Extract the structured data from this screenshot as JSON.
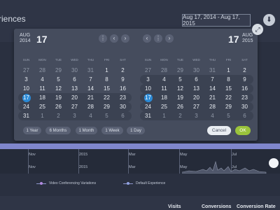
{
  "header": {
    "title": "riences",
    "date_range": "Aug 17, 2014 - Aug 17, 2015",
    "download_icon": "download-icon",
    "expand_icon": "expand-icon"
  },
  "calendars": {
    "left": {
      "month": "AUG",
      "year": "2014",
      "selected_day": "17",
      "buttons": [
        "⋮",
        "‹",
        "›"
      ]
    },
    "right": {
      "month": "AUG",
      "year": "2015",
      "selected_day": "17",
      "buttons": [
        "‹",
        "⋮",
        "›"
      ]
    },
    "weekdays": [
      "SUN",
      "MON",
      "TUE",
      "WED",
      "THU",
      "FRI",
      "SAT"
    ],
    "weeks": [
      [
        "27",
        "28",
        "29",
        "30",
        "31",
        "1",
        "2"
      ],
      [
        "3",
        "4",
        "5",
        "6",
        "7",
        "8",
        "9"
      ],
      [
        "10",
        "11",
        "12",
        "13",
        "14",
        "15",
        "16"
      ],
      [
        "17",
        "18",
        "19",
        "20",
        "21",
        "22",
        "23"
      ],
      [
        "24",
        "25",
        "26",
        "27",
        "28",
        "29",
        "30"
      ],
      [
        "31",
        "1",
        "2",
        "3",
        "4",
        "5",
        "6"
      ]
    ]
  },
  "presets": [
    "1 Year",
    "6 Months",
    "1 Month",
    "1 Week",
    "1 Day"
  ],
  "actions": {
    "cancel": "Cancel",
    "ok": "OK"
  },
  "timeline": {
    "top_labels": [
      "Nov",
      "2015",
      "Mar",
      "May",
      "Jul"
    ],
    "bottom_labels": [
      "Nov",
      "2015",
      "Mar",
      "May",
      "Jul"
    ]
  },
  "legend": [
    {
      "label": "Video Conferencing Variations",
      "color": "#b28ae0"
    },
    {
      "label": "Default Experience",
      "color": "#8fa0e0"
    }
  ],
  "table": {
    "columns": [
      "Visits",
      "Conversions",
      "Conversion Rate"
    ]
  },
  "colors": {
    "accent_blue": "#2b8ad6",
    "ok_green": "#9bc43c",
    "timeline": "#7f86cc"
  }
}
